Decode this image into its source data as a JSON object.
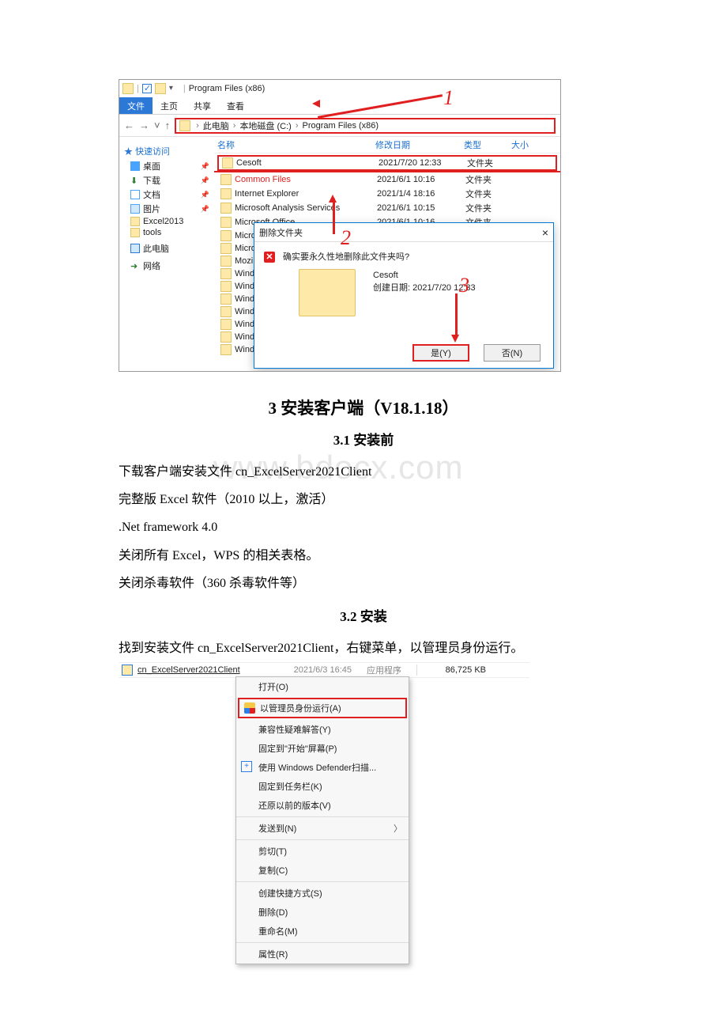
{
  "fig1": {
    "titlebar": {
      "qat_items": [
        "folder-icon",
        "checkbox",
        "folder-icon",
        "dropdown"
      ],
      "window_title": "Program Files (x86)"
    },
    "ribbon_tabs": {
      "file": "文件",
      "home": "主页",
      "share": "共享",
      "view": "查看"
    },
    "addressbar": {
      "back": "←",
      "forward": "→",
      "dropdown": "˅",
      "up": "↑",
      "segments": [
        "此电脑",
        "本地磁盘 (C:)",
        "Program Files (x86)"
      ]
    },
    "quick_access_title": "快速访问",
    "sidebar": {
      "quick": [
        {
          "icon": "desktop",
          "label": "桌面",
          "pinned": true
        },
        {
          "icon": "download",
          "label": "下载",
          "pinned": true
        },
        {
          "icon": "docs",
          "label": "文档",
          "pinned": true
        },
        {
          "icon": "pics",
          "label": "图片",
          "pinned": true
        },
        {
          "icon": "folder",
          "label": "Excel2013",
          "pinned": false
        },
        {
          "icon": "folder",
          "label": "tools",
          "pinned": false
        }
      ],
      "this_pc": "此电脑",
      "network": "网络"
    },
    "columns": {
      "name": "名称",
      "date": "修改日期",
      "type": "类型",
      "size": "大小"
    },
    "cesoft": {
      "name": "Cesoft",
      "date": "2021/7/20 12:33",
      "type": "文件夹"
    },
    "rows": [
      {
        "name": "Common Files",
        "date": "2021/6/1 10:16",
        "type": "文件夹"
      },
      {
        "name": "Internet Explorer",
        "date": "2021/1/4 18:16",
        "type": "文件夹"
      },
      {
        "name": "Microsoft Analysis Services",
        "date": "2021/6/1 10:15",
        "type": "文件夹"
      },
      {
        "name": "Microsoft Office",
        "date": "2021/6/1 10:16",
        "type": "文件夹"
      },
      {
        "name": "Micro",
        "date": "",
        "type": ""
      },
      {
        "name": "Micro",
        "date": "",
        "type": ""
      },
      {
        "name": "Mozi",
        "date": "",
        "type": ""
      },
      {
        "name": "Wind",
        "date": "",
        "type": ""
      },
      {
        "name": "Wind",
        "date": "",
        "type": ""
      },
      {
        "name": "Wind",
        "date": "",
        "type": ""
      },
      {
        "name": "Wind",
        "date": "",
        "type": ""
      },
      {
        "name": "Wind",
        "date": "",
        "type": ""
      },
      {
        "name": "Wind",
        "date": "",
        "type": ""
      },
      {
        "name": "Wind",
        "date": "",
        "type": ""
      }
    ],
    "dialog": {
      "title": "删除文件夹",
      "question": "确实要永久性地删除此文件夹吗?",
      "item_name": "Cesoft",
      "created_line": "创建日期: 2021/7/20 12:33",
      "yes": "是(Y)",
      "no": "否(N)",
      "close": "×"
    },
    "annotations": {
      "a1": "1",
      "a2": "2",
      "a3": "3"
    }
  },
  "headings": {
    "h1": "3 安装客户端（V18.1.18）",
    "h2a": "3.1 安装前",
    "h2b": "3.2 安装"
  },
  "watermark": "www.bdocx.com",
  "body": {
    "p1": "下载客户端安装文件 cn_ExcelServer2021Client",
    "p2": "完整版 Excel 软件（2010 以上，激活）",
    "p3": ".Net framework 4.0",
    "p4": "关闭所有 Excel，WPS 的相关表格。",
    "p5": "关闭杀毒软件（360 杀毒软件等）",
    "p6": "找到安装文件 cn_ExcelServer2021Client，右键菜单，以管理员身份运行。"
  },
  "fig2": {
    "file": {
      "name": "cn_ExcelServer2021Client",
      "date": "2021/6/3 16:45",
      "type": "应用程序",
      "size": "86,725 KB"
    },
    "menu": [
      {
        "label": "打开(O)",
        "sep": false
      },
      {
        "label": "以管理员身份运行(A)",
        "sep": false,
        "shield": true,
        "highlight": true
      },
      {
        "label": "兼容性疑难解答(Y)",
        "sep": false
      },
      {
        "label": "固定到\"开始\"屏幕(P)",
        "sep": false
      },
      {
        "label": "使用 Windows Defender扫描...",
        "sep": false,
        "dplus": true
      },
      {
        "label": "固定到任务栏(K)",
        "sep": false
      },
      {
        "label": "还原以前的版本(V)",
        "sep": true
      },
      {
        "label": "发送到(N)",
        "sep": true,
        "chevron": true
      },
      {
        "label": "剪切(T)",
        "sep": false
      },
      {
        "label": "复制(C)",
        "sep": true
      },
      {
        "label": "创建快捷方式(S)",
        "sep": false
      },
      {
        "label": "删除(D)",
        "sep": false
      },
      {
        "label": "重命名(M)",
        "sep": true
      },
      {
        "label": "属性(R)",
        "sep": false
      }
    ]
  }
}
